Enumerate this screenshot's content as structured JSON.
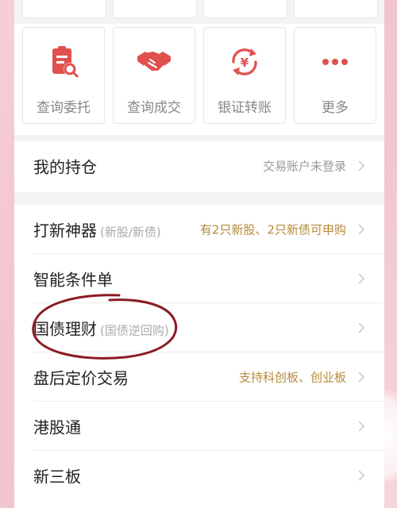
{
  "quick_actions": [
    {
      "label": "查询委托",
      "icon": "clipboard-search-icon"
    },
    {
      "label": "查询成交",
      "icon": "handshake-icon"
    },
    {
      "label": "银证转账",
      "icon": "yen-transfer-icon"
    },
    {
      "label": "更多",
      "icon": "more-dots-icon"
    }
  ],
  "holdings": {
    "title": "我的持仓",
    "status": "交易账户未登录"
  },
  "menu": [
    {
      "title": "打新神器",
      "sub": "(新股/新债)",
      "right": "有2只新股、2只新债可申购"
    },
    {
      "title": "智能条件单",
      "sub": "",
      "right": ""
    },
    {
      "title": "国债理财",
      "sub": "(国债逆回购)",
      "right": ""
    },
    {
      "title": "盘后定价交易",
      "sub": "",
      "right": "支持科创板、创业板"
    },
    {
      "title": "港股通",
      "sub": "",
      "right": ""
    },
    {
      "title": "新三板",
      "sub": "",
      "right": ""
    }
  ],
  "colors": {
    "accent": "#e0504e",
    "highlight_text": "#b78a3a",
    "annotation": "#8b1a24"
  }
}
